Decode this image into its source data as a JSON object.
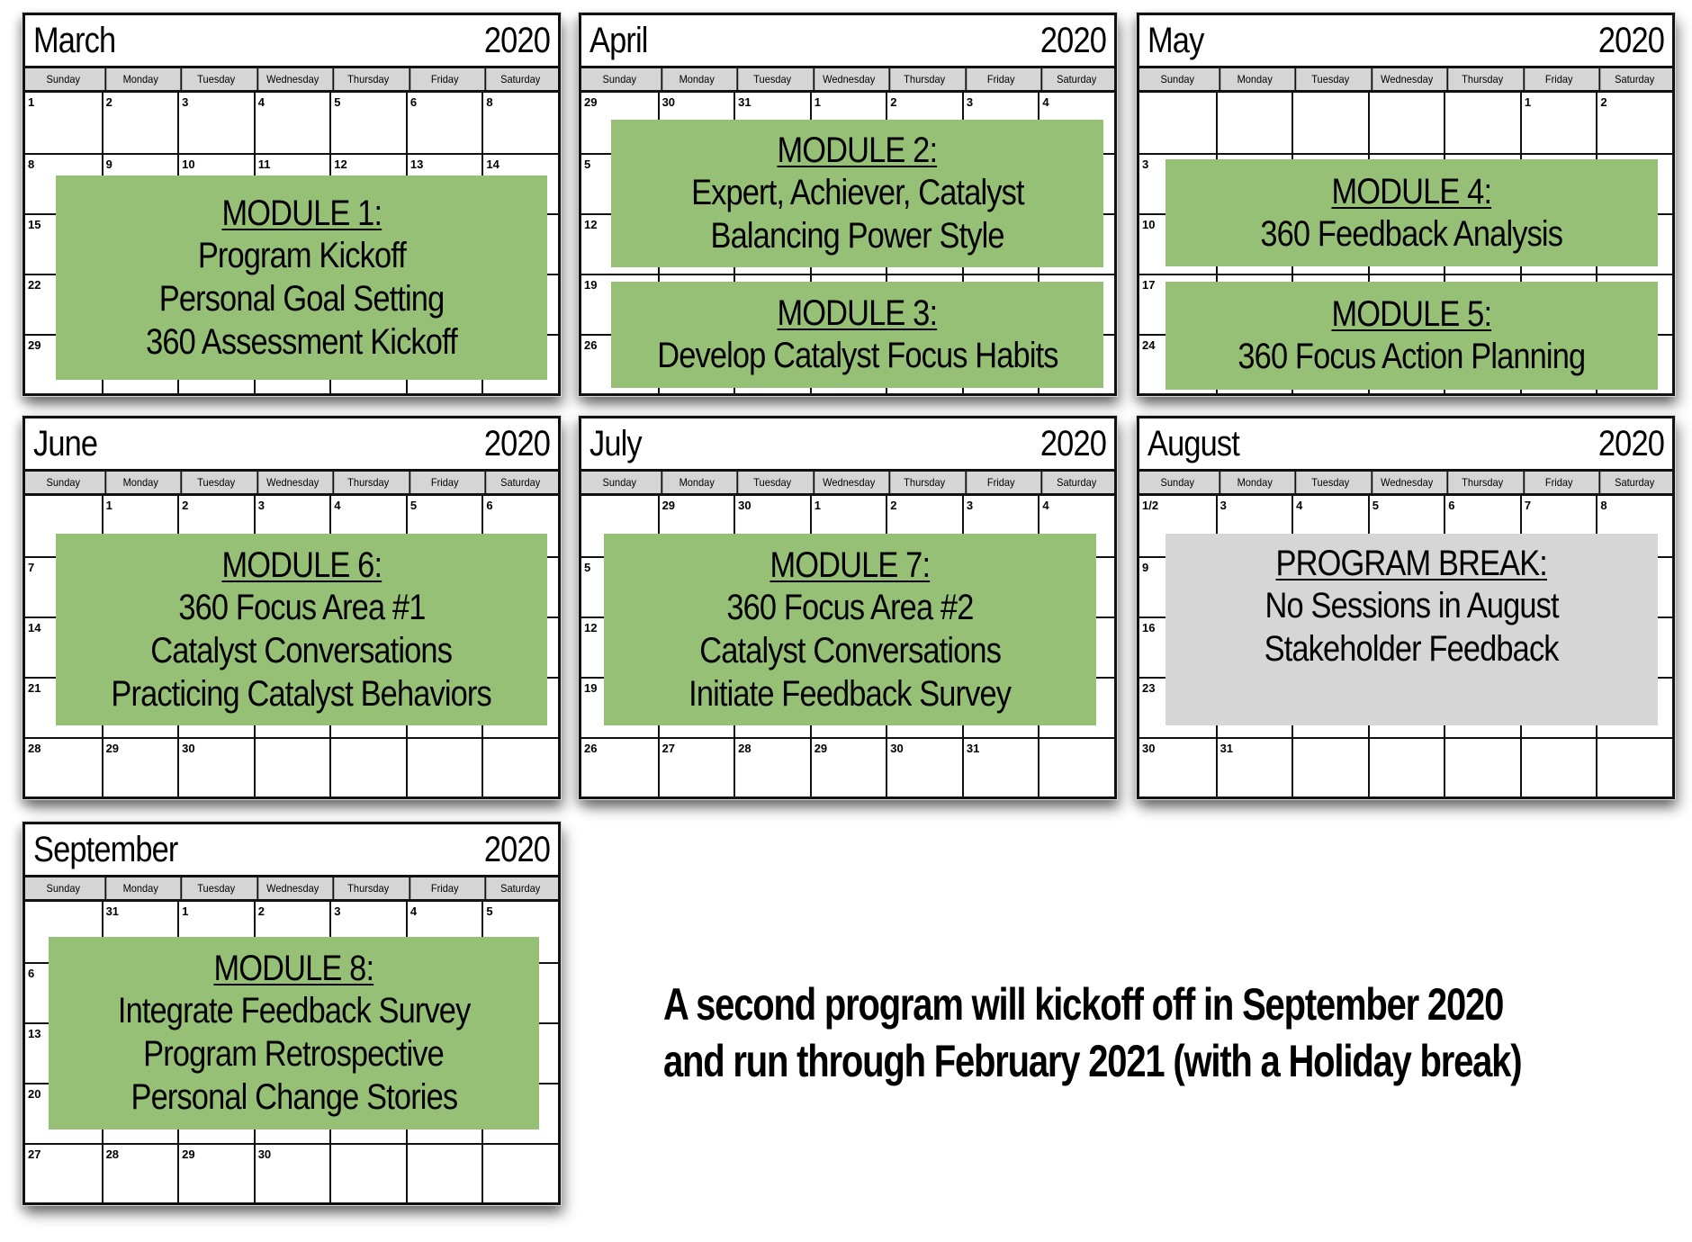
{
  "weekdays": [
    "Sunday",
    "Monday",
    "Tuesday",
    "Wednesday",
    "Thursday",
    "Friday",
    "Saturday"
  ],
  "calendars": [
    {
      "month": "March",
      "year": "2020",
      "weeks": [
        [
          "1",
          "2",
          "3",
          "4",
          "5",
          "6",
          "8"
        ],
        [
          "8",
          "9",
          "10",
          "11",
          "12",
          "13",
          "14"
        ],
        [
          "15",
          "",
          "",
          "",
          "",
          "",
          ""
        ],
        [
          "22",
          "",
          "",
          "",
          "",
          "",
          ""
        ],
        [
          "29",
          "",
          "",
          "",
          "",
          "",
          ""
        ]
      ],
      "modules": [
        {
          "heading": "MODULE 1:",
          "lines": [
            "Program Kickoff",
            "Personal Goal Setting",
            "360 Assessment Kickoff"
          ],
          "style": "green"
        }
      ]
    },
    {
      "month": "April",
      "year": "2020",
      "weeks": [
        [
          "29",
          "30",
          "31",
          "1",
          "2",
          "3",
          "4"
        ],
        [
          "5",
          "",
          "",
          "",
          "",
          "",
          ""
        ],
        [
          "12",
          "",
          "",
          "",
          "",
          "",
          ""
        ],
        [
          "19",
          "",
          "",
          "",
          "",
          "",
          ""
        ],
        [
          "26",
          "",
          "",
          "",
          "",
          "",
          ""
        ]
      ],
      "modules": [
        {
          "heading": "MODULE 2:",
          "lines": [
            "Expert, Achiever, Catalyst",
            "Balancing Power Style"
          ],
          "style": "green"
        },
        {
          "heading": "MODULE 3:",
          "lines": [
            "Develop Catalyst Focus Habits"
          ],
          "style": "green"
        }
      ]
    },
    {
      "month": "May",
      "year": "2020",
      "weeks": [
        [
          "",
          "",
          "",
          "",
          "",
          "1",
          "2"
        ],
        [
          "3",
          "",
          "",
          "",
          "",
          "",
          ""
        ],
        [
          "10",
          "",
          "",
          "",
          "",
          "",
          ""
        ],
        [
          "17",
          "",
          "",
          "",
          "",
          "",
          ""
        ],
        [
          "24",
          "",
          "",
          "",
          "",
          "",
          ""
        ]
      ],
      "modules": [
        {
          "heading": "MODULE 4:",
          "lines": [
            "360 Feedback Analysis"
          ],
          "style": "green"
        },
        {
          "heading": "MODULE 5:",
          "lines": [
            "360 Focus Action Planning"
          ],
          "style": "green"
        }
      ]
    },
    {
      "month": "June",
      "year": "2020",
      "weeks": [
        [
          "",
          "1",
          "2",
          "3",
          "4",
          "5",
          "6"
        ],
        [
          "7",
          "",
          "",
          "",
          "",
          "",
          ""
        ],
        [
          "14",
          "",
          "",
          "",
          "",
          "",
          ""
        ],
        [
          "21",
          "",
          "",
          "",
          "",
          "",
          ""
        ],
        [
          "28",
          "29",
          "30",
          "",
          "",
          "",
          ""
        ]
      ],
      "modules": [
        {
          "heading": "MODULE 6:",
          "lines": [
            "360 Focus Area #1",
            "Catalyst Conversations",
            "Practicing Catalyst Behaviors"
          ],
          "style": "green"
        }
      ]
    },
    {
      "month": "July",
      "year": "2020",
      "weeks": [
        [
          "",
          "29",
          "30",
          "1",
          "2",
          "3",
          "4"
        ],
        [
          "5",
          "",
          "",
          "",
          "",
          "",
          ""
        ],
        [
          "12",
          "",
          "",
          "",
          "",
          "",
          ""
        ],
        [
          "19",
          "",
          "",
          "",
          "",
          "",
          ""
        ],
        [
          "26",
          "27",
          "28",
          "29",
          "30",
          "31",
          ""
        ]
      ],
      "modules": [
        {
          "heading": "MODULE 7:",
          "lines": [
            "360 Focus Area #2",
            "Catalyst Conversations",
            "Initiate Feedback Survey"
          ],
          "style": "green"
        }
      ]
    },
    {
      "month": "August",
      "year": "2020",
      "weeks": [
        [
          "1/2",
          "3",
          "4",
          "5",
          "6",
          "7",
          "8"
        ],
        [
          "9",
          "",
          "",
          "",
          "",
          "",
          ""
        ],
        [
          "16",
          "",
          "",
          "",
          "",
          "",
          ""
        ],
        [
          "23",
          "",
          "",
          "",
          "",
          "",
          ""
        ],
        [
          "30",
          "31",
          "",
          "",
          "",
          "",
          ""
        ]
      ],
      "modules": [
        {
          "heading": "PROGRAM BREAK:",
          "lines": [
            "No Sessions in August",
            "Stakeholder Feedback"
          ],
          "style": "gray"
        }
      ]
    },
    {
      "month": "September",
      "year": "2020",
      "weeks": [
        [
          "",
          "31",
          "1",
          "2",
          "3",
          "4",
          "5"
        ],
        [
          "6",
          "",
          "",
          "",
          "",
          "",
          ""
        ],
        [
          "13",
          "",
          "",
          "",
          "",
          "",
          ""
        ],
        [
          "20",
          "",
          "",
          "",
          "",
          "",
          ""
        ],
        [
          "27",
          "28",
          "29",
          "30",
          "",
          "",
          ""
        ]
      ],
      "modules": [
        {
          "heading": "MODULE 8:",
          "lines": [
            "Integrate Feedback Survey",
            "Program Retrospective",
            "Personal Change Stories"
          ],
          "style": "green"
        }
      ]
    }
  ],
  "note": {
    "line1": "A second program will kickoff off in September 2020",
    "line2": "and run through February 2021 (with a Holiday break)"
  },
  "colors": {
    "module_green": "#97c077",
    "break_gray": "#d6d6d6",
    "weekday_header": "#d5d5d5"
  }
}
